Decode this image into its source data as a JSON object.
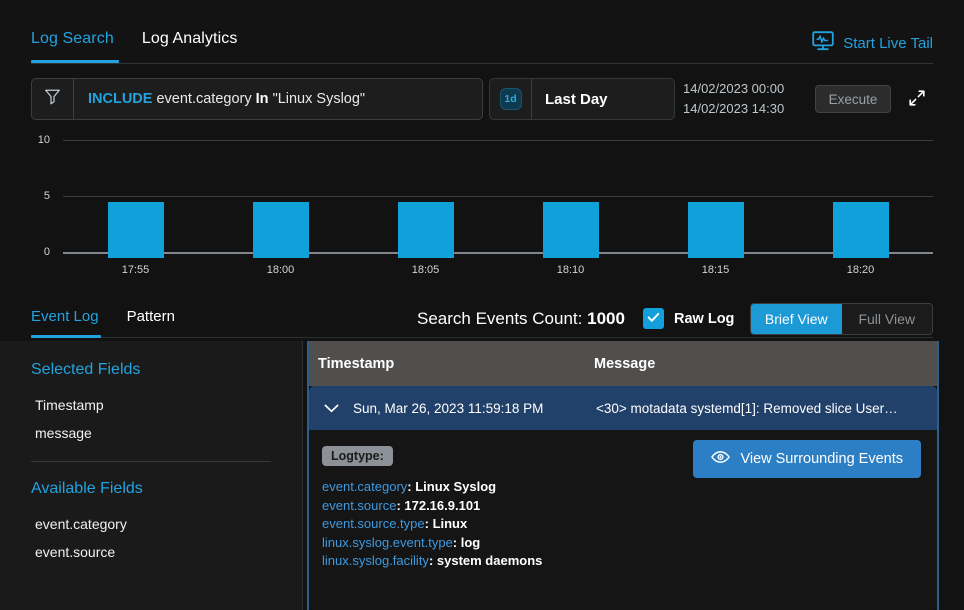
{
  "header": {
    "tabs": [
      {
        "label": "Log Search",
        "active": true
      },
      {
        "label": "Log Analytics",
        "active": false
      }
    ],
    "live_tail": {
      "label": "Start Live Tail",
      "icon": "monitor-waveform-icon",
      "color": "#21a3e0"
    }
  },
  "query": {
    "filter_icon": "funnel-icon",
    "include_keyword": "INCLUDE",
    "field": "event.category",
    "operator": "In",
    "value": "\"Linux Syslog\"",
    "time": {
      "badge": "1d",
      "label": "Last Day"
    },
    "range_from": "14/02/2023 00:00",
    "range_to": "14/02/2023 14:30",
    "execute_label": "Execute",
    "expand_icon": "expand-diagonal-icon"
  },
  "chart_data": {
    "type": "bar",
    "title": "",
    "xlabel": "",
    "ylabel": "",
    "categories": [
      "17:55",
      "18:00",
      "18:05",
      "18:10",
      "18:15",
      "18:20"
    ],
    "values": [
      5,
      5,
      5,
      5,
      5,
      5
    ],
    "ylim": [
      0,
      10
    ],
    "yticks": [
      0,
      5,
      10
    ],
    "grid": true,
    "legend": false,
    "bar_color": "#10a0da"
  },
  "results": {
    "tabs": [
      {
        "label": "Event Log",
        "active": true
      },
      {
        "label": "Pattern",
        "active": false
      }
    ],
    "count_label": "Search Events Count:",
    "count_value": "1000",
    "raw_log_label": "Raw Log",
    "raw_log_checked": true,
    "views": [
      {
        "label": "Brief View",
        "active": true
      },
      {
        "label": "Full View",
        "active": false
      }
    ]
  },
  "sidebar": {
    "selected_heading": "Selected Fields",
    "selected_fields": [
      "Timestamp",
      "message"
    ],
    "available_heading": "Available Fields",
    "available_fields": [
      "event.category",
      "event.source"
    ]
  },
  "table": {
    "columns": [
      "Timestamp",
      "Message"
    ],
    "row": {
      "chevron": "chevron-down-icon",
      "timestamp": "Sun, Mar 26, 2023 11:59:18 PM",
      "message": "<30> motadata systemd[1]: Removed slice User…"
    }
  },
  "detail": {
    "logtype_label": "Logtype:",
    "action_label": "View Surrounding Events",
    "action_icon": "eye-icon",
    "fields": [
      {
        "key": "event.category",
        "value": "Linux Syslog"
      },
      {
        "key": "event.source",
        "value": "172.16.9.101"
      },
      {
        "key": "event.source.type",
        "value": "Linux"
      },
      {
        "key": "linux.syslog.event.type",
        "value": "log"
      },
      {
        "key": "linux.syslog.facility",
        "value": "system daemons"
      }
    ]
  }
}
